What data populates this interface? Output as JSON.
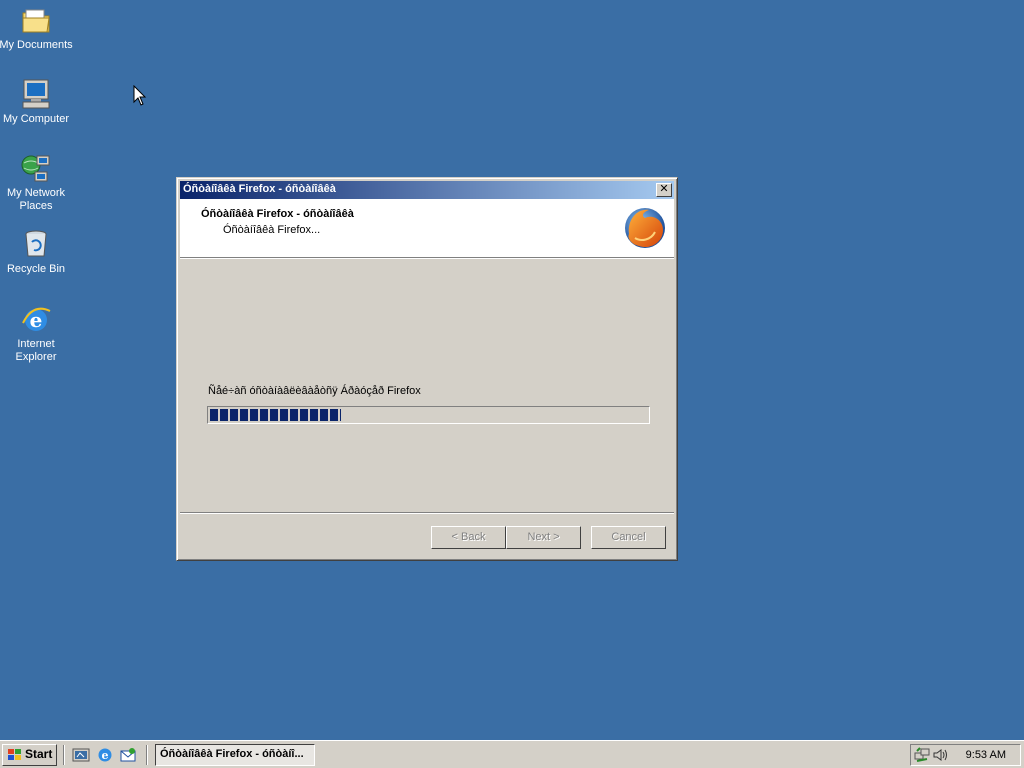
{
  "desktop": {
    "icons": [
      {
        "label": "My Documents"
      },
      {
        "label": "My Computer"
      },
      {
        "label": "My Network Places"
      },
      {
        "label": "Recycle Bin"
      },
      {
        "label": "Internet Explorer"
      }
    ]
  },
  "dialog": {
    "title": "Óñòàíîâêà Firefox - óñòàíîâêà",
    "header_title": "Óñòàíîâêà Firefox - óñòàíîâêà",
    "header_subtitle": "Óñòàíîâêà Firefox...",
    "status_text": "Ñåé÷àñ óñòàíàâëèâàåòñÿ Áðàóçåð Firefox",
    "progress_fraction": 0.3,
    "buttons": {
      "back": "< Back",
      "next": "Next >",
      "cancel": "Cancel"
    },
    "close_glyph": "✕"
  },
  "taskbar": {
    "start_label": "Start",
    "task_label": "Óñòàíîâêà Firefox - óñòàíî...",
    "clock": "9:53 AM"
  },
  "colors": {
    "desktop": "#3a6ea5",
    "titlebar_start": "#0a246a",
    "titlebar_end": "#a6caf0",
    "progress_block": "#0a246a"
  }
}
